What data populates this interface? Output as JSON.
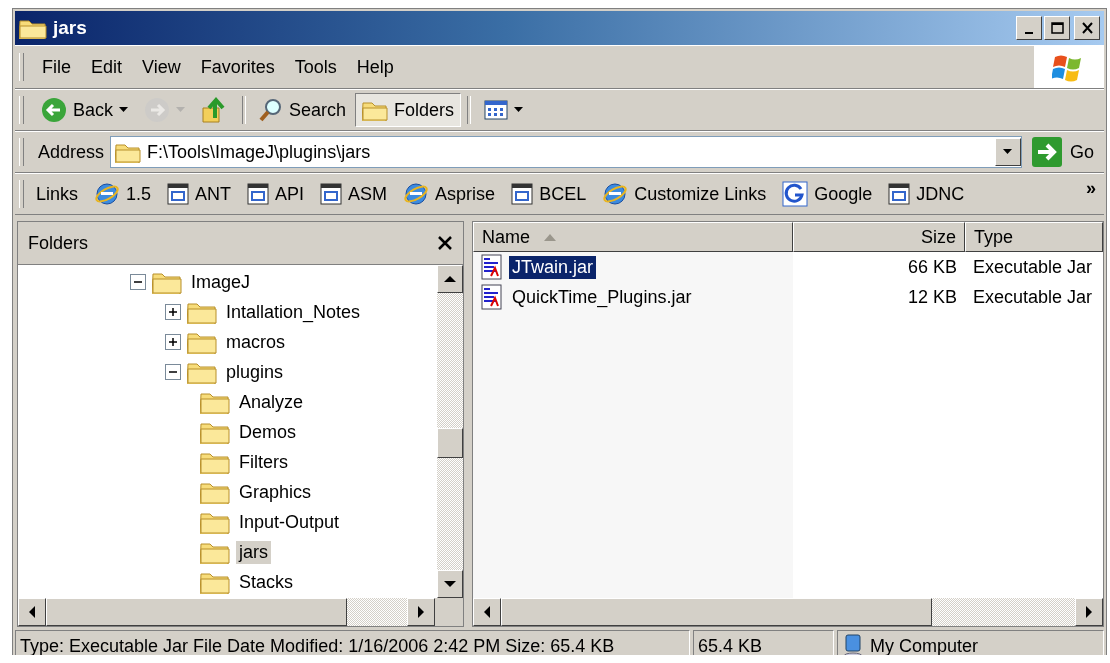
{
  "window": {
    "title": "jars"
  },
  "menu": [
    "File",
    "Edit",
    "View",
    "Favorites",
    "Tools",
    "Help"
  ],
  "toolbar": [
    {
      "kind": "back",
      "label": "Back",
      "disabled": false,
      "pressed": false
    },
    {
      "kind": "forward",
      "disabled": true,
      "pressed": false
    },
    {
      "kind": "up",
      "disabled": false,
      "pressed": false
    },
    {
      "kind": "search",
      "label": "Search",
      "disabled": false,
      "pressed": false
    },
    {
      "kind": "folders",
      "label": "Folders",
      "disabled": false,
      "pressed": true
    },
    {
      "kind": "views",
      "disabled": false,
      "pressed": false
    }
  ],
  "address": {
    "label": "Address",
    "value": "F:\\Tools\\ImageJ\\plugins\\jars",
    "go": "Go"
  },
  "links": {
    "label": "Links",
    "more": "»",
    "items": [
      {
        "label": "1.5",
        "kind": "ie"
      },
      {
        "label": "ANT",
        "kind": "page"
      },
      {
        "label": "API",
        "kind": "page"
      },
      {
        "label": "ASM",
        "kind": "page"
      },
      {
        "label": "Asprise",
        "kind": "ie"
      },
      {
        "label": "BCEL",
        "kind": "page"
      },
      {
        "label": "Customize Links",
        "kind": "ie"
      },
      {
        "label": "Google",
        "kind": "google"
      },
      {
        "label": "JDNC",
        "kind": "page"
      }
    ]
  },
  "folders_pane": {
    "title": "Folders",
    "tree": [
      {
        "label": "ImageJ",
        "expanded": true,
        "selected": false,
        "children": [
          {
            "label": "Intallation_Notes",
            "expanded": false,
            "selected": false
          },
          {
            "label": "macros",
            "expanded": false,
            "selected": false
          },
          {
            "label": "plugins",
            "expanded": true,
            "selected": false,
            "children": [
              {
                "label": "Analyze",
                "selected": false
              },
              {
                "label": "Demos",
                "selected": false
              },
              {
                "label": "Filters",
                "selected": false
              },
              {
                "label": "Graphics",
                "selected": false
              },
              {
                "label": "Input-Output",
                "selected": false
              },
              {
                "label": "jars",
                "selected": true
              },
              {
                "label": "Stacks",
                "selected": false
              }
            ]
          }
        ]
      }
    ]
  },
  "file_list": {
    "columns": [
      {
        "label": "Name",
        "sorted": true
      },
      {
        "label": "Size",
        "sorted": false
      },
      {
        "label": "Type",
        "sorted": false
      }
    ],
    "rows": [
      {
        "name": "JTwain.jar",
        "size": "66 KB",
        "type": "Executable Jar",
        "selected": true
      },
      {
        "name": "QuickTime_Plugins.jar",
        "size": "12 KB",
        "type": "Executable Jar",
        "selected": false
      }
    ]
  },
  "status_bar": {
    "text": "Type: Executable Jar File Date Modified: 1/16/2006 2:42 PM Size: 65.4 KB",
    "size": "65.4 KB",
    "zone": "My Computer"
  }
}
